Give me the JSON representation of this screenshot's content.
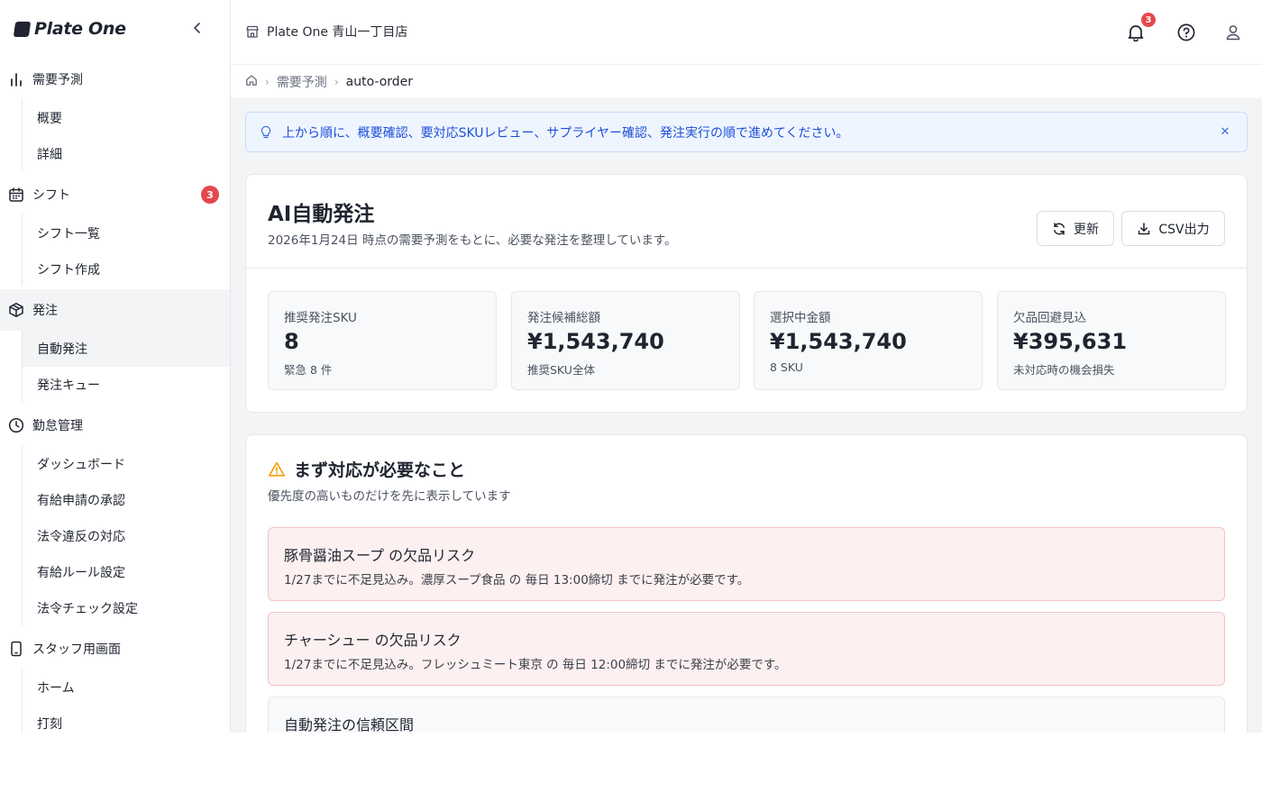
{
  "brand": {
    "name": "Plate One"
  },
  "sidebar": {
    "groups": [
      {
        "label": "需要予測",
        "icon": "bar-chart-icon",
        "items": [
          "概要",
          "詳細"
        ]
      },
      {
        "label": "シフト",
        "icon": "calendar-icon",
        "badge": "3",
        "items": [
          "シフト一覧",
          "シフト作成"
        ]
      },
      {
        "label": "発注",
        "icon": "package-icon",
        "active": true,
        "items": [
          "自動発注",
          "発注キュー"
        ],
        "active_item": "自動発注"
      },
      {
        "label": "勤怠管理",
        "icon": "clock-icon",
        "items": [
          "ダッシュボード",
          "有給申請の承認",
          "法令違反の対応",
          "有給ルール設定",
          "法令チェック設定"
        ]
      },
      {
        "label": "スタッフ用画面",
        "icon": "smartphone-icon",
        "items": [
          "ホーム",
          "打刻"
        ]
      }
    ]
  },
  "header": {
    "store_name": "Plate One 青山一丁目店",
    "notification_count": "3",
    "icons": [
      "bell-icon",
      "help-circle-icon",
      "user-icon"
    ]
  },
  "breadcrumb": {
    "items": [
      "需要予測",
      "auto-order"
    ]
  },
  "tip": {
    "text": "上から順に、概要確認、要対応SKUレビュー、サプライヤー確認、発注実行の順で進めてください。"
  },
  "overview": {
    "title": "AI自動発注",
    "subtitle": "2026年1月24日 時点の需要予測をもとに、必要な発注を整理しています。",
    "refresh_label": "更新",
    "csv_label": "CSV出力",
    "kpis": [
      {
        "label": "推奨発注SKU",
        "value": "8",
        "note": "緊急 8 件"
      },
      {
        "label": "発注候補総額",
        "value": "¥1,543,740",
        "note": "推奨SKU全体"
      },
      {
        "label": "選択中金額",
        "value": "¥1,543,740",
        "note": "8 SKU"
      },
      {
        "label": "欠品回避見込",
        "value": "¥395,631",
        "note": "未対応時の機会損失"
      }
    ]
  },
  "attention": {
    "title": "まず対応が必要なこと",
    "subtitle": "優先度の高いものだけを先に表示しています",
    "alerts": [
      {
        "title": "豚骨醤油スープ の欠品リスク",
        "text": "1/27までに不足見込み。濃厚スープ食品 の 毎日 13:00締切 までに発注が必要です。"
      },
      {
        "title": "チャーシュー の欠品リスク",
        "text": "1/27までに不足見込み。フレッシュミート東京 の 毎日 12:00締切 までに発注が必要です。"
      }
    ],
    "confidence_title": "自動発注の信頼区間"
  },
  "colors": {
    "accent_red": "#e5484d",
    "tip_blue": "#1d4ed8",
    "warning": "#f59e0b"
  }
}
